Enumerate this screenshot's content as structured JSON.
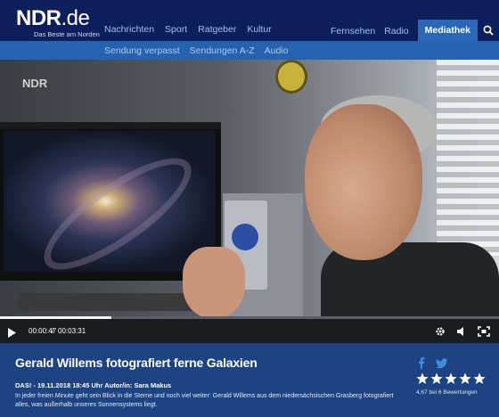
{
  "header": {
    "logo_main": "NDR",
    "logo_tld": ".de",
    "logo_tagline": "Das Beste am Norden",
    "nav_left": [
      "Nachrichten",
      "Sport",
      "Ratgeber",
      "Kultur"
    ],
    "nav_right": [
      "Fernsehen",
      "Radio"
    ],
    "nav_active": "Mediathek",
    "search_icon": "search-icon"
  },
  "subnav": {
    "items": [
      "Sendung verpasst",
      "Sendungen A-Z",
      "Audio"
    ]
  },
  "player": {
    "watermark": "NDR",
    "time_current": "00:00:47",
    "time_separator": "/",
    "time_total": "00:03:31",
    "progress_fraction": 0.223,
    "icons": [
      "play-icon",
      "gear-icon",
      "volume-icon",
      "fullscreen-icon"
    ]
  },
  "info": {
    "title": "Gerald Willems fotografiert ferne Galaxien",
    "meta": "DAS! - 19.11.2018 18:45 Uhr Autor/in: Sara Makus",
    "description": "In jeder freien Minute geht sein Blick in die Sterne und noch viel weiter: Gerald Willems aus dem niedersächsischen Grasberg fotografiert alles, was außerhalb unseres Sonnensystems liegt.",
    "rating_text": "4,67 bei 6 Bewertungen",
    "stars": 5,
    "share_icons": [
      "facebook-icon",
      "twitter-icon"
    ]
  },
  "colors": {
    "header_bg": "#0c1f5c",
    "subnav_bg": "#2563b0",
    "info_bg": "#1d4382",
    "active_tab": "#2a67b8"
  }
}
